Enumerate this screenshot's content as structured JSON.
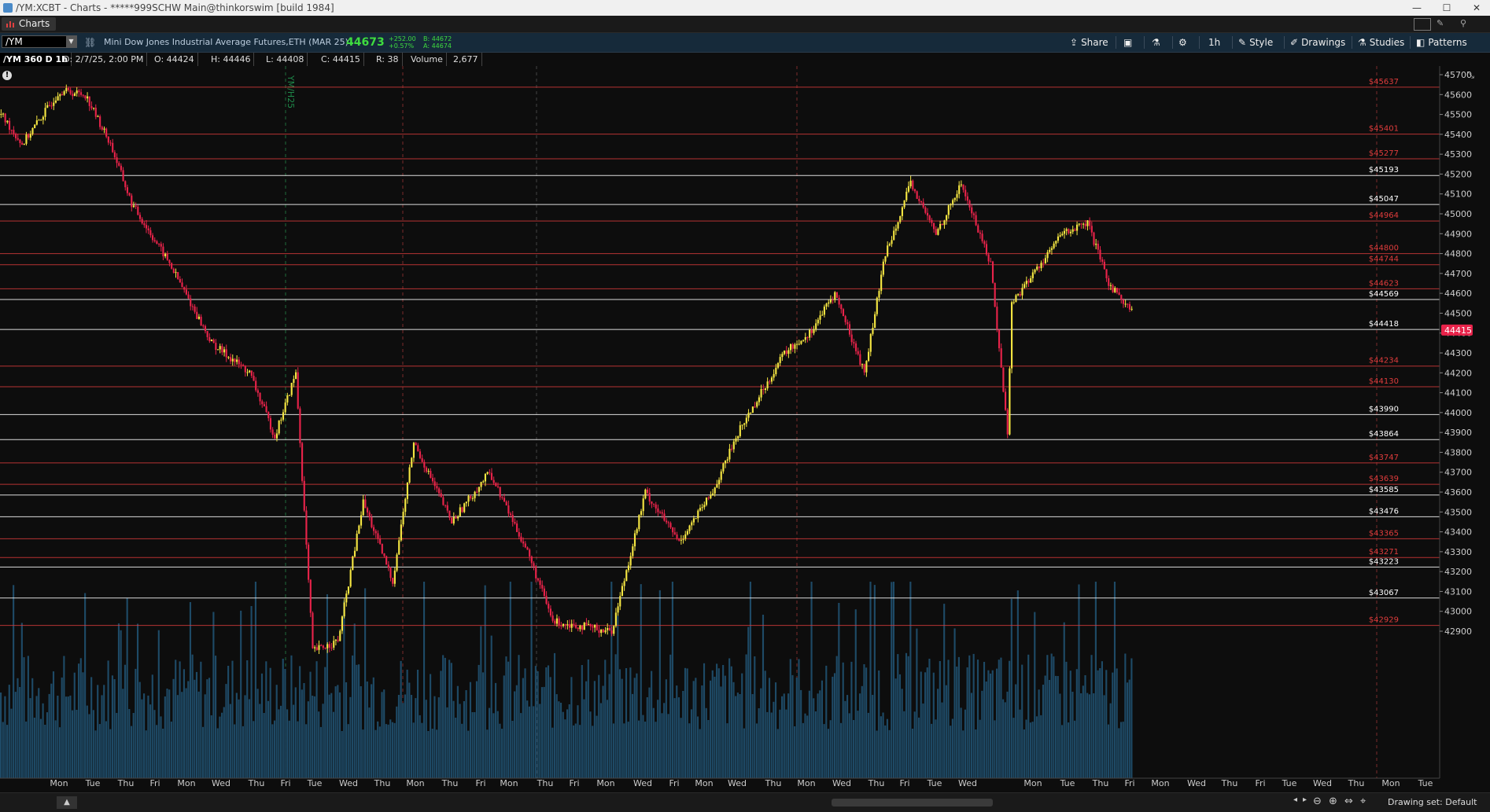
{
  "window": {
    "title": "/YM:XCBT - Charts - *****999SCHW Main@thinkorswim [build 1984]",
    "controls": {
      "minimize": "—",
      "maximize": "☐",
      "close": "✕"
    }
  },
  "app_tab": {
    "label": "Charts"
  },
  "toolbar": {
    "symbol": "/YM",
    "description": "Mini Dow Jones Industrial Average Futures,ETH (MAR 25)",
    "last_price": "44673",
    "net_change": "+252.00",
    "pct_change": "+0.57%",
    "bid": "B: 44672",
    "ask": "A: 44674",
    "buttons": {
      "share": "Share",
      "timeframe": "1h",
      "style": "Style",
      "drawings": "Drawings",
      "studies": "Studies",
      "patterns": "Patterns"
    },
    "icons": {
      "share": "share-icon",
      "screenshot": "camera-icon",
      "flask": "flask-icon",
      "settings": "gear-icon",
      "link": "link-icon"
    }
  },
  "info_bar": [
    "/YM 360 D 1h",
    "D: 2/7/25, 2:00 PM",
    "O: 44424",
    "H: 44446",
    "L: 44408",
    "C: 44415",
    "R: 38",
    "Volume",
    "2,677"
  ],
  "status_bar": {
    "drawing_set": "Drawing set: Default"
  },
  "chart_data": {
    "type": "candlestick",
    "y_axis": {
      "min": 42850,
      "max": 45800,
      "ticks": [
        42900,
        43000,
        43100,
        43200,
        43300,
        43400,
        43500,
        43600,
        43700,
        43800,
        43900,
        44000,
        44100,
        44200,
        44300,
        44400,
        44500,
        44600,
        44700,
        44800,
        44900,
        45000,
        45100,
        45200,
        45300,
        45400,
        45500,
        45600,
        45700
      ]
    },
    "x_ticks": [
      "Mon",
      "Tue",
      "Thu",
      "Fri",
      "Mon",
      "Wed",
      "Thu",
      "Fri",
      "Tue",
      "Wed",
      "Thu",
      "Mon",
      "Thu",
      "Fri",
      "Mon",
      "Thu",
      "Fri",
      "Mon",
      "Wed",
      "Fri",
      "Mon",
      "Wed",
      "Thu",
      "Mon",
      "Wed",
      "Thu",
      "Fri",
      "Tue",
      "Wed",
      "Mon",
      "Tue",
      "Thu",
      "Fri",
      "Mon",
      "Wed",
      "Thu",
      "Fri",
      "Tue",
      "Wed",
      "Thu",
      "Mon",
      "Tue"
    ],
    "current_price": "44415",
    "current_price_value": 44415,
    "levels": [
      {
        "price": 45637,
        "label": "$45637",
        "color": "#e03c3c"
      },
      {
        "price": 45401,
        "label": "$45401",
        "color": "#e03c3c"
      },
      {
        "price": 45277,
        "label": "$45277",
        "color": "#e03c3c"
      },
      {
        "price": 45193,
        "label": "$45193",
        "color": "#ffffff"
      },
      {
        "price": 45047,
        "label": "$45047",
        "color": "#ffffff"
      },
      {
        "price": 44964,
        "label": "$44964",
        "color": "#e03c3c"
      },
      {
        "price": 44800,
        "label": "$44800",
        "color": "#e03c3c"
      },
      {
        "price": 44744,
        "label": "$44744",
        "color": "#e03c3c"
      },
      {
        "price": 44623,
        "label": "$44623",
        "color": "#e03c3c"
      },
      {
        "price": 44569,
        "label": "$44569",
        "color": "#ffffff"
      },
      {
        "price": 44418,
        "label": "$44418",
        "color": "#ffffff"
      },
      {
        "price": 44234,
        "label": "$44234",
        "color": "#e03c3c"
      },
      {
        "price": 44130,
        "label": "$44130",
        "color": "#e03c3c"
      },
      {
        "price": 43990,
        "label": "$43990",
        "color": "#ffffff"
      },
      {
        "price": 43864,
        "label": "$43864",
        "color": "#ffffff"
      },
      {
        "price": 43747,
        "label": "$43747",
        "color": "#e03c3c"
      },
      {
        "price": 43639,
        "label": "$43639",
        "color": "#e03c3c"
      },
      {
        "price": 43585,
        "label": "$43585",
        "color": "#ffffff"
      },
      {
        "price": 43476,
        "label": "$43476",
        "color": "#ffffff"
      },
      {
        "price": 43365,
        "label": "$43365",
        "color": "#e03c3c"
      },
      {
        "price": 43271,
        "label": "$43271",
        "color": "#e03c3c"
      },
      {
        "price": 43223,
        "label": "$43223",
        "color": "#ffffff"
      },
      {
        "price": 43067,
        "label": "$43067",
        "color": "#ffffff"
      },
      {
        "price": 42929,
        "label": "$42929",
        "color": "#e03c3c"
      }
    ],
    "marker_label": "YM/H25",
    "colors": {
      "up": "#f5e642",
      "down": "#e8234a",
      "volume": "#1e4a66",
      "grid": "#2a2a2a",
      "background": "#0d0d0d",
      "price_tag": "#e8234a"
    }
  }
}
